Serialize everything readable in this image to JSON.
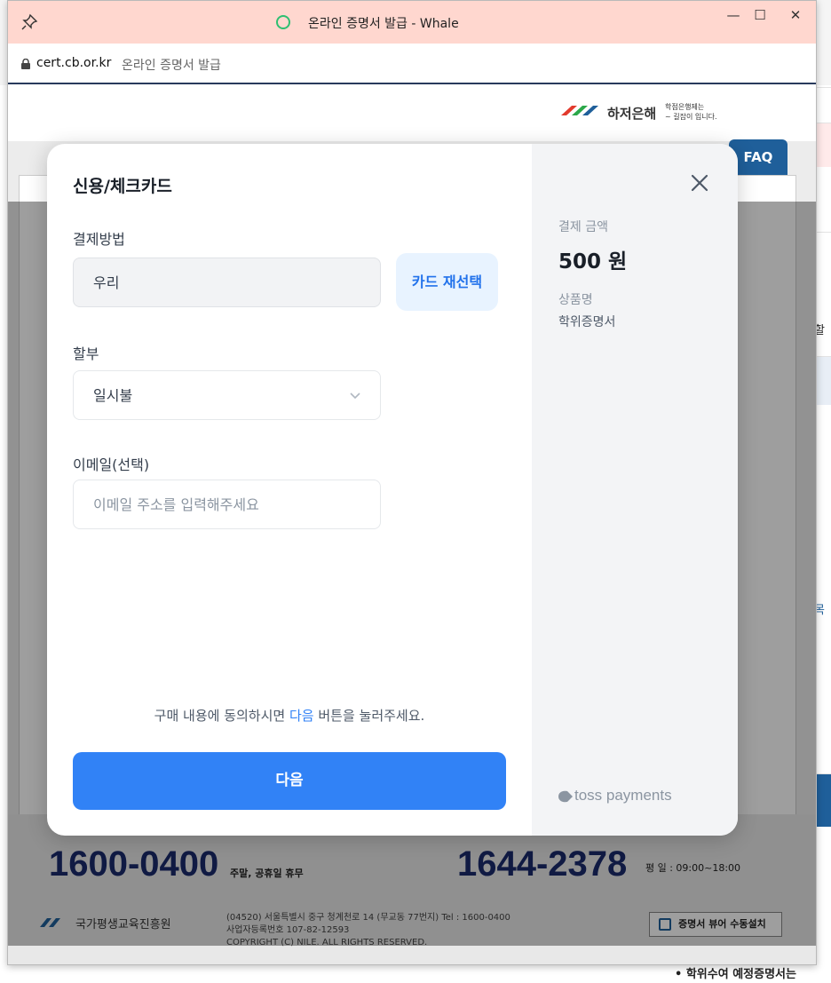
{
  "window": {
    "title": "온라인 증명서 발급 - Whale",
    "controls": {
      "minimize": "—",
      "maximize": "☐",
      "close": "✕"
    }
  },
  "address": {
    "host": "cert.cb.or.kr",
    "page_title": "온라인 증명서 발급"
  },
  "site": {
    "bank_name": "하저은해",
    "bank_tagline": "학점은행제는\n~ 길잡이 입니다.",
    "faq_tab": "FAQ",
    "footer": {
      "phone1": "1600-0400",
      "phone1_note": "주말, 공휴일 휴무",
      "phone2": "1644-2378",
      "phone2_hours": "평  일 : 09:00~18:00",
      "org_name": "국가평생교육진흥원",
      "address_lines": [
        "(04520) 서울특별시 중구 청계천로 14 (무교동 77번지)  Tel : 1600-0400",
        "사업자등록번호 107-82-12593",
        "COPYRIGHT (C) NILE. ALL RIGHTS RESERVED."
      ],
      "viewer_button": "증명서 뷰어 수동설치"
    }
  },
  "background_page": {
    "right_fragments": [
      "할",
      "목"
    ],
    "bottom_bullet": "• 학위수여 예정증명서는"
  },
  "payment": {
    "title": "신용/체크카드",
    "method_label": "결제방법",
    "method_value": "우리",
    "reselect_button": "카드 재선택",
    "installment_label": "할부",
    "installment_value": "일시불",
    "email_label": "이메일(선택)",
    "email_placeholder": "이메일 주소를 입력해주세요",
    "consent_before": "구매 내용에 동의하시면 ",
    "consent_highlight": "다음",
    "consent_after": " 버튼을 눌러주세요.",
    "next_button": "다음",
    "summary": {
      "amount_label": "결제 금액",
      "amount": "500 원",
      "product_label": "상품명",
      "product": "학위증명서"
    },
    "brand": "toss payments"
  },
  "colors": {
    "titlebar": "#ffd7cf",
    "primary": "#3182f6",
    "reselect_bg": "#e8f3ff",
    "navy": "#1a2b6d"
  }
}
